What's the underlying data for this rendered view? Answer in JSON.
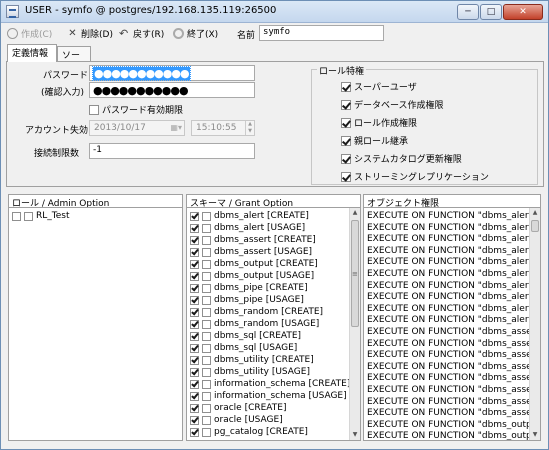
{
  "window": {
    "title": "USER - symfo @ postgres/192.168.135.119:26500",
    "minimize": "─",
    "maximize": "□",
    "close": "✕"
  },
  "toolbar": {
    "create_label": "作成(C)",
    "delete_label": "削除(D)",
    "back_label": "戻す(R)",
    "exit_label": "終了(X)",
    "name_label": "名前",
    "name_value": "symfo"
  },
  "tabs": [
    {
      "label": "定義情報"
    },
    {
      "label": "ソース"
    }
  ],
  "form": {
    "password_label": "パスワード",
    "password_confirm_label": "(確認入力)",
    "password_value": "●●●●●●●●●●●",
    "password_confirm_value": "●●●●●●●●●●●",
    "password_expiry_label": "パスワード有効期限",
    "password_expiry_checked": false,
    "account_expiry_label": "アカウント失効",
    "expiry_date": "2013/10/17",
    "expiry_time": "15:10:55",
    "conn_limit_label": "接続制限数",
    "conn_limit_value": "-1"
  },
  "role_privileges": {
    "title": "ロール特権",
    "items": [
      {
        "label": "スーパーユーザ",
        "checked": true
      },
      {
        "label": "データベース作成権限",
        "checked": true
      },
      {
        "label": "ロール作成権限",
        "checked": true
      },
      {
        "label": "親ロール継承",
        "checked": true
      },
      {
        "label": "システムカタログ更新権限",
        "checked": true
      },
      {
        "label": "ストリーミングレプリケーション",
        "checked": true
      }
    ]
  },
  "role_list": {
    "header": "ロール / Admin Option",
    "items": [
      {
        "label": "RL_Test",
        "checked": false,
        "admin": false
      }
    ]
  },
  "schema_list": {
    "header": "スキーマ / Grant Option",
    "items": [
      {
        "label": "dbms_alert [CREATE]",
        "checked": true,
        "grant": false
      },
      {
        "label": "dbms_alert [USAGE]",
        "checked": true,
        "grant": false
      },
      {
        "label": "dbms_assert [CREATE]",
        "checked": true,
        "grant": false
      },
      {
        "label": "dbms_assert [USAGE]",
        "checked": true,
        "grant": false
      },
      {
        "label": "dbms_output [CREATE]",
        "checked": true,
        "grant": false
      },
      {
        "label": "dbms_output [USAGE]",
        "checked": true,
        "grant": false
      },
      {
        "label": "dbms_pipe [CREATE]",
        "checked": true,
        "grant": false
      },
      {
        "label": "dbms_pipe [USAGE]",
        "checked": true,
        "grant": false
      },
      {
        "label": "dbms_random [CREATE]",
        "checked": true,
        "grant": false
      },
      {
        "label": "dbms_random [USAGE]",
        "checked": true,
        "grant": false
      },
      {
        "label": "dbms_sql [CREATE]",
        "checked": true,
        "grant": false
      },
      {
        "label": "dbms_sql [USAGE]",
        "checked": true,
        "grant": false
      },
      {
        "label": "dbms_utility [CREATE]",
        "checked": true,
        "grant": false
      },
      {
        "label": "dbms_utility [USAGE]",
        "checked": true,
        "grant": false
      },
      {
        "label": "information_schema [CREATE]",
        "checked": true,
        "grant": false
      },
      {
        "label": "information_schema [USAGE]",
        "checked": true,
        "grant": false
      },
      {
        "label": "oracle [CREATE]",
        "checked": true,
        "grant": false
      },
      {
        "label": "oracle [USAGE]",
        "checked": true,
        "grant": false
      },
      {
        "label": "pg_catalog [CREATE]",
        "checked": true,
        "grant": false
      }
    ]
  },
  "object_list": {
    "header": "オブジェクト権限",
    "items": [
      "EXECUTE ON FUNCTION \"dbms_alert\".",
      "EXECUTE ON FUNCTION \"dbms_alert\".",
      "EXECUTE ON FUNCTION \"dbms_alert\".",
      "EXECUTE ON FUNCTION \"dbms_alert\".",
      "EXECUTE ON FUNCTION \"dbms_alert\".",
      "EXECUTE ON FUNCTION \"dbms_alert\".",
      "EXECUTE ON FUNCTION \"dbms_alert\".",
      "EXECUTE ON FUNCTION \"dbms_alert\".",
      "EXECUTE ON FUNCTION \"dbms_alert\".",
      "EXECUTE ON FUNCTION \"dbms_alert\".",
      "EXECUTE ON FUNCTION \"dbms_asser",
      "EXECUTE ON FUNCTION \"dbms_asser",
      "EXECUTE ON FUNCTION \"dbms_asser",
      "EXECUTE ON FUNCTION \"dbms_asser",
      "EXECUTE ON FUNCTION \"dbms_asser",
      "EXECUTE ON FUNCTION \"dbms_asser",
      "EXECUTE ON FUNCTION \"dbms_asser",
      "EXECUTE ON FUNCTION \"dbms_asser",
      "EXECUTE ON FUNCTION \"dbms_outpu",
      "EXECUTE ON FUNCTION \"dbms_outpu"
    ]
  }
}
